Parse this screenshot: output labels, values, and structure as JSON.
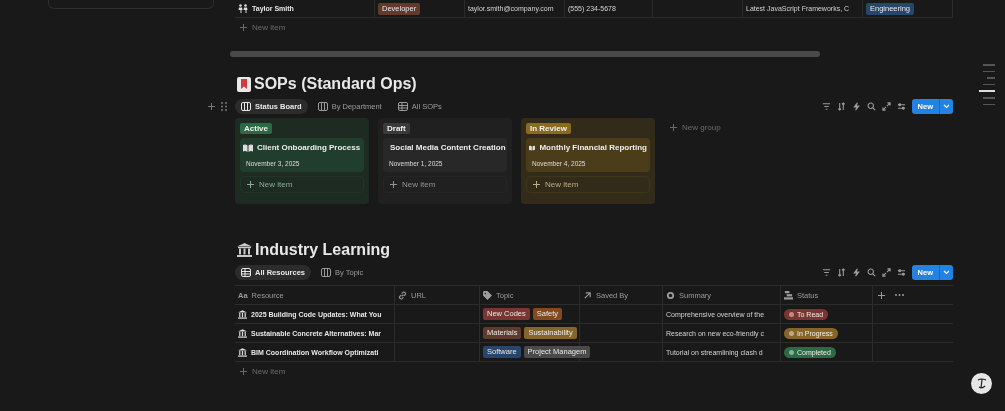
{
  "people_table": {
    "rows": [
      {
        "name": "Taylor Smith",
        "role": {
          "label": "Developer",
          "color": "#603b2c"
        },
        "email": "taylor.smith@company.com",
        "phone": "(555) 234-5678",
        "interests": "Latest JavaScript Frameworks, C",
        "team": {
          "label": "Engineering",
          "color": "#28456c"
        }
      }
    ],
    "new_item": "New item"
  },
  "sops": {
    "title": "SOPs (Standard Ops)",
    "views": [
      {
        "label": "Status Board",
        "kind": "board",
        "selected": true
      },
      {
        "label": "By Department",
        "kind": "board",
        "selected": false
      },
      {
        "label": "All SOPs",
        "kind": "table",
        "selected": false
      }
    ],
    "new_button": "New",
    "groups": [
      {
        "label": "Active",
        "color": "#2b6a45",
        "cards": [
          {
            "title": "Client Onboarding Process",
            "date": "November 3, 2025"
          }
        ],
        "new_item": "New item"
      },
      {
        "label": "Draft",
        "color": "#3a3a3a",
        "cards": [
          {
            "title": "Social Media Content Creation",
            "date": "November 1, 2025"
          }
        ],
        "new_item": "New item"
      },
      {
        "label": "In Review",
        "color": "#8a6a1c",
        "cards": [
          {
            "title": "Monthly Financial Reporting",
            "date": "November 4, 2025"
          }
        ],
        "new_item": "New item"
      }
    ],
    "new_group": "New group"
  },
  "learning": {
    "title": "Industry Learning",
    "views": [
      {
        "label": "All Resources",
        "kind": "table",
        "selected": true
      },
      {
        "label": "By Topic",
        "kind": "board",
        "selected": false
      }
    ],
    "new_button": "New",
    "columns": [
      {
        "label": "Aa",
        "kind": "title",
        "name": "Resource"
      },
      {
        "kind": "url",
        "name": "URL"
      },
      {
        "kind": "tags",
        "name": "Topic"
      },
      {
        "kind": "person",
        "name": "Saved By"
      },
      {
        "kind": "text",
        "name": "Summary"
      },
      {
        "kind": "status",
        "name": "Status"
      }
    ],
    "rows": [
      {
        "resource": "2025 Building Code Updates: What You",
        "topics": [
          {
            "label": "New Codes",
            "color": "#7a3530"
          },
          {
            "label": "Safety",
            "color": "#85491f"
          }
        ],
        "summary": "Comprehensive overview of the",
        "status": {
          "label": "To Read",
          "color": "#7a3530"
        }
      },
      {
        "resource": "Sustainable Concrete Alternatives: Mar",
        "topics": [
          {
            "label": "Materials",
            "color": "#603b2c"
          },
          {
            "label": "Sustainability",
            "color": "#87652a"
          }
        ],
        "summary": "Research on new eco-friendly c",
        "status": {
          "label": "In Progress",
          "color": "#87652a"
        }
      },
      {
        "resource": "BIM Coordination Workflow Optimizati",
        "topics": [
          {
            "label": "Software",
            "color": "#28456c"
          },
          {
            "label": "Project Managem",
            "color": "#4a4a4a"
          }
        ],
        "summary": "Tutorial on streamlining clash d",
        "status": {
          "label": "Completed",
          "color": "#2b6a45"
        }
      }
    ],
    "new_item": "New item"
  }
}
